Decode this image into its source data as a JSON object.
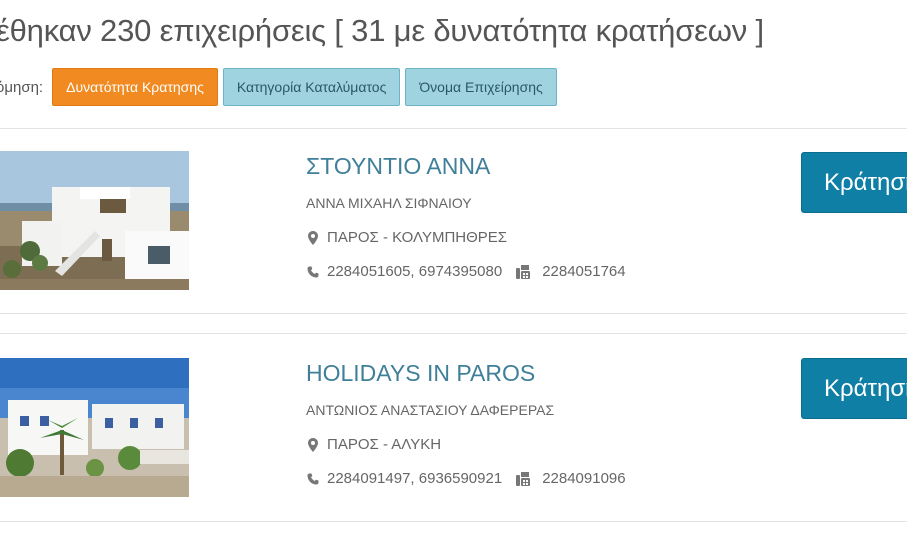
{
  "results": {
    "heading": "έθηκαν 230 επιχειρήσεις [ 31 με δυνατότητα κρατήσεων ]"
  },
  "sort": {
    "label": "όμηση:",
    "options": [
      {
        "label": "Δυνατότητα Κρατησης",
        "active": true
      },
      {
        "label": "Κατηγορία Καταλύματος",
        "active": false
      },
      {
        "label": "Όνομα Επιχείρησης",
        "active": false
      }
    ]
  },
  "listings": [
    {
      "name": "ΣΤΟΥΝΤΙΟ ΑΝΝΑ",
      "owner": "ΑΝΝΑ ΜΙΧΑΗΛ ΣΙΦΝΑΙΟΥ",
      "location": "ΠΑΡΟΣ - ΚΟΛΥΜΠΗΘΡΕΣ",
      "phones": "2284051605, 6974395080",
      "fax": "2284051764",
      "book_label": "Κράτηση"
    },
    {
      "name": "HOLIDAYS IN PAROS",
      "owner": "ΑΝΤΩΝΙΟΣ ΑΝΑΣΤΑΣΙΟΥ ΔΑΦΕΡΕΡΑΣ",
      "location": "ΠΑΡΟΣ - ΑΛΥΚΗ",
      "phones": "2284091497, 6936590921",
      "fax": "2284091096",
      "book_label": "Κράτηση"
    }
  ],
  "icons": {
    "location": "map-marker-icon",
    "phone": "phone-icon",
    "fax": "fax-icon"
  },
  "colors": {
    "accent_orange": "#f18a21",
    "sort_inactive": "#9fd3e0",
    "link_blue": "#3f7f99",
    "book_button": "#0f7fa5"
  }
}
